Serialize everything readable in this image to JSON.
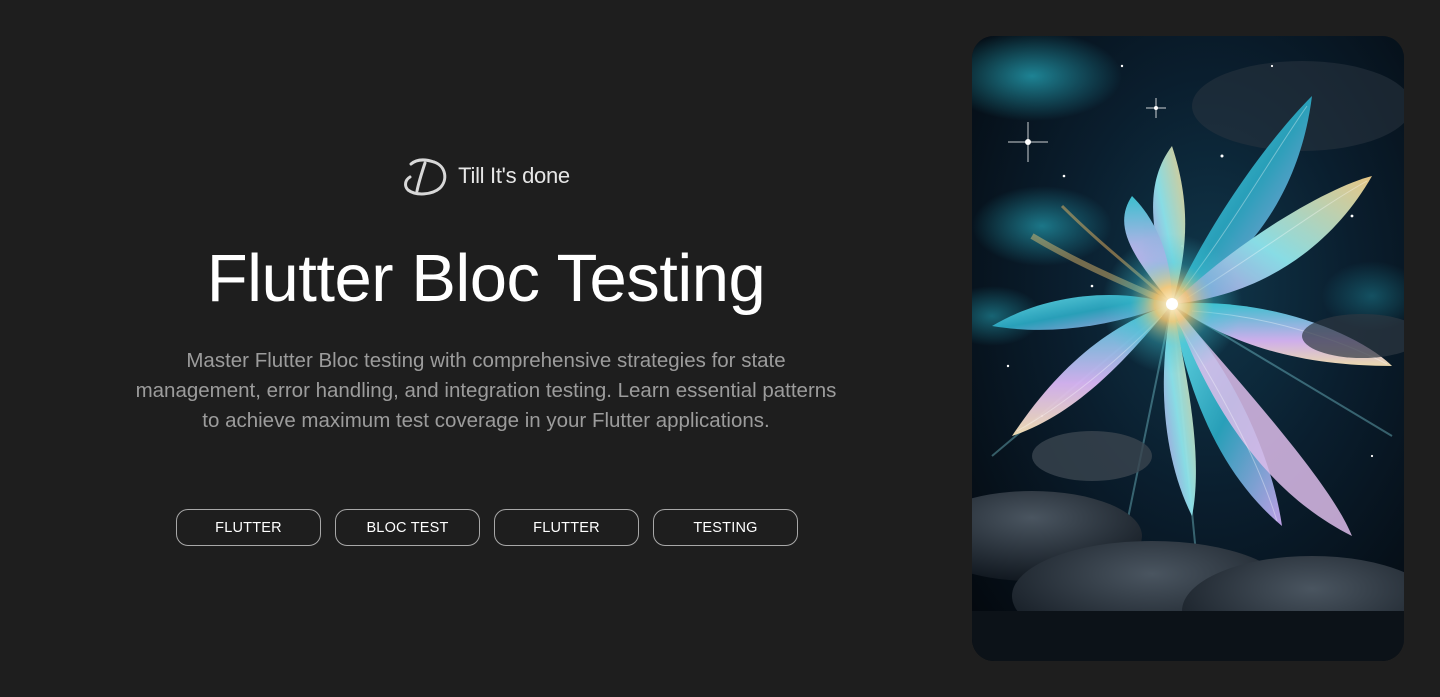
{
  "brand": {
    "logo_icon": "td-monogram-icon",
    "name": "Till It's done"
  },
  "hero": {
    "title": "Flutter Bloc Testing",
    "description": "Master Flutter Bloc testing with comprehensive strategies for state management, error handling, and integration testing. Learn essential patterns to achieve maximum test coverage in your Flutter applications.",
    "tags": [
      {
        "label": "FLUTTER"
      },
      {
        "label": "BLOC TEST"
      },
      {
        "label": "FLUTTER"
      },
      {
        "label": "TESTING"
      }
    ]
  },
  "image": {
    "subject": "cosmic-crystal-flower-art",
    "colors": {
      "background": "#1e1e1e",
      "space": "#07121d",
      "teal": "#3ec7d6",
      "violet": "#b98be0",
      "gold": "#f3c872"
    }
  }
}
